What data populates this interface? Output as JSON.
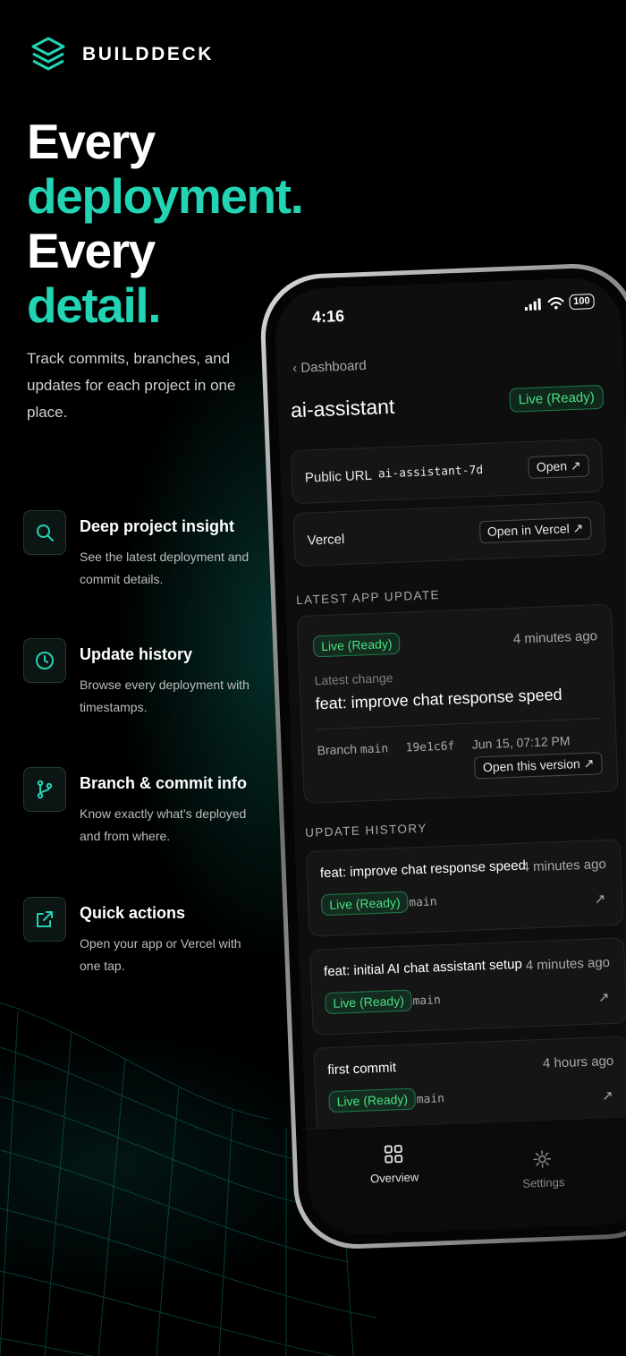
{
  "brand": {
    "name": "BUILDDECK",
    "icon": "stacked-layers-icon",
    "accent": "#22d3b4"
  },
  "hero": {
    "line1": "Every",
    "line2": "deployment.",
    "line3": "Every",
    "line4": "detail.",
    "subtext": "Track commits, branches, and updates for each project in one place."
  },
  "features": [
    {
      "icon": "search-icon",
      "title": "Deep project insight",
      "desc": "See the latest deployment and commit details."
    },
    {
      "icon": "clock-icon",
      "title": "Update history",
      "desc": "Browse every deployment with timestamps."
    },
    {
      "icon": "git-branch-icon",
      "title": "Branch & commit info",
      "desc": "Know exactly what's deployed and from where."
    },
    {
      "icon": "external-link-icon",
      "title": "Quick actions",
      "desc": "Open your app or Vercel with one tap."
    }
  ],
  "phone": {
    "status": {
      "time": "4:16",
      "battery": "100"
    },
    "back_label": "Dashboard",
    "project": {
      "name": "ai-assistant",
      "status": "Live (Ready)"
    },
    "public_url": {
      "label": "Public URL",
      "value": "ai-assistant-7d",
      "action": "Open ↗"
    },
    "vercel": {
      "label": "Vercel",
      "action": "Open in Vercel ↗"
    },
    "latest": {
      "section_title": "LATEST APP UPDATE",
      "status": "Live (Ready)",
      "time": "4 minutes ago",
      "change_label": "Latest change",
      "message": "feat: improve chat response speed",
      "branch_label": "Branch",
      "branch": "main",
      "commit": "19e1c6f",
      "date": "Jun 15, 07:12 PM",
      "action": "Open this version ↗"
    },
    "history": {
      "section_title": "UPDATE HISTORY",
      "items": [
        {
          "title": "feat: improve chat response speed",
          "time": "4 minutes ago",
          "status": "Live (Ready)",
          "branch": "main",
          "arrow": "↗"
        },
        {
          "title": "feat: initial AI chat assistant setup",
          "time": "4 minutes ago",
          "status": "Live (Ready)",
          "branch": "main",
          "arrow": "↗"
        },
        {
          "title": "first commit",
          "time": "4 hours ago",
          "status": "Live (Ready)",
          "branch": "main",
          "arrow": "↗"
        }
      ]
    },
    "tabs": [
      {
        "label": "Overview",
        "icon": "grid-icon",
        "active": true
      },
      {
        "label": "Settings",
        "icon": "gear-icon",
        "active": false
      }
    ]
  },
  "colors": {
    "accent": "#22d3b4",
    "live_green": "#4ade80",
    "background": "#000000"
  }
}
